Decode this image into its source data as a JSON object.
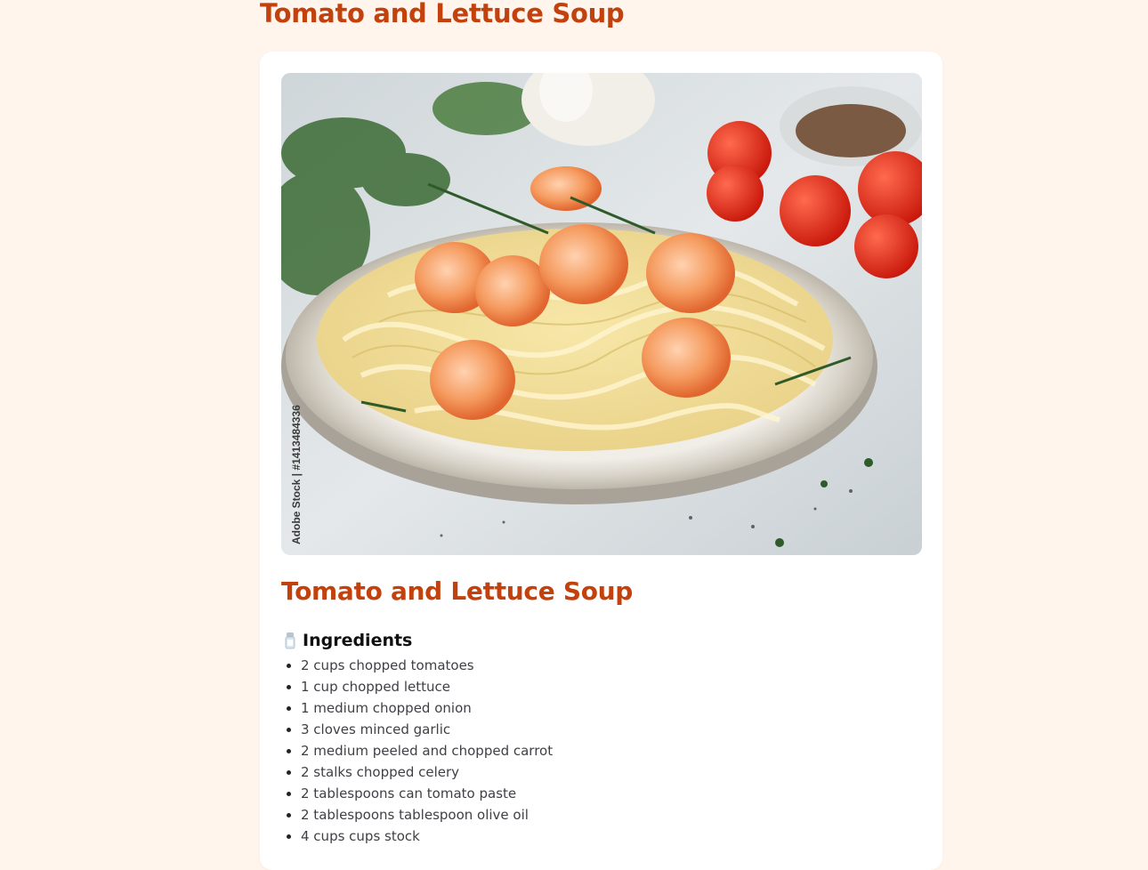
{
  "page": {
    "title": "Tomato and Lettuce Soup"
  },
  "recipe": {
    "title": "Tomato and Lettuce Soup",
    "image": {
      "icon": "shrimp-pasta-photo",
      "watermark": "Adobe Stock | #1413484336"
    },
    "ingredients_heading": "Ingredients",
    "ingredients_icon": "salt-shaker-icon",
    "ingredients": [
      "2 cups chopped tomatoes",
      "1 cup chopped lettuce",
      "1 medium chopped onion",
      "3 cloves minced garlic",
      "2 medium peeled and chopped carrot",
      "2 stalks chopped celery",
      "2 tablespoons can tomato paste",
      "2 tablespoons tablespoon olive oil",
      "4 cups cups stock"
    ]
  },
  "colors": {
    "background": "#fff5ec",
    "accent": "#c2410c",
    "card": "#ffffff",
    "text": "#3f3f46"
  }
}
